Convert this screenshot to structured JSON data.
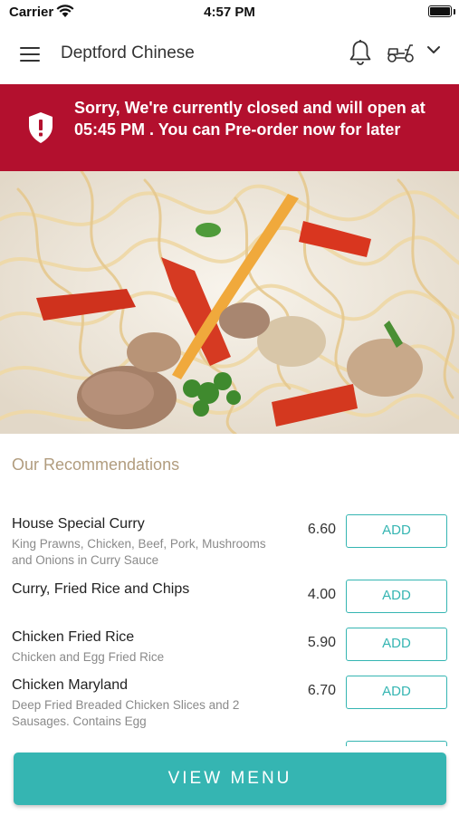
{
  "status_bar": {
    "carrier": "Carrier",
    "time": "4:57 PM"
  },
  "header": {
    "title": "Deptford Chinese"
  },
  "banner": {
    "message": "Sorry, We're currently closed and will open at 05:45 PM . You can Pre-order now for later",
    "color": "#b3102e"
  },
  "recommendations": {
    "title": "Our Recommendations",
    "add_label": "ADD",
    "items": [
      {
        "name": "House Special Curry",
        "description": "King Prawns, Chicken, Beef, Pork, Mushrooms and Onions in Curry Sauce",
        "price": "6.60"
      },
      {
        "name": "Curry, Fried Rice and Chips",
        "description": "",
        "price": "4.00"
      },
      {
        "name": "Chicken Fried Rice",
        "description": "Chicken and Egg Fried Rice",
        "price": "5.90"
      },
      {
        "name": "Chicken Maryland",
        "description": "Deep Fried Breaded Chicken Slices and 2 Sausages. Contains Egg",
        "price": "6.70"
      }
    ]
  },
  "footer": {
    "view_menu_label": "VIEW MENU"
  },
  "colors": {
    "accent": "#35b5b2",
    "heading": "#b19c7e"
  }
}
